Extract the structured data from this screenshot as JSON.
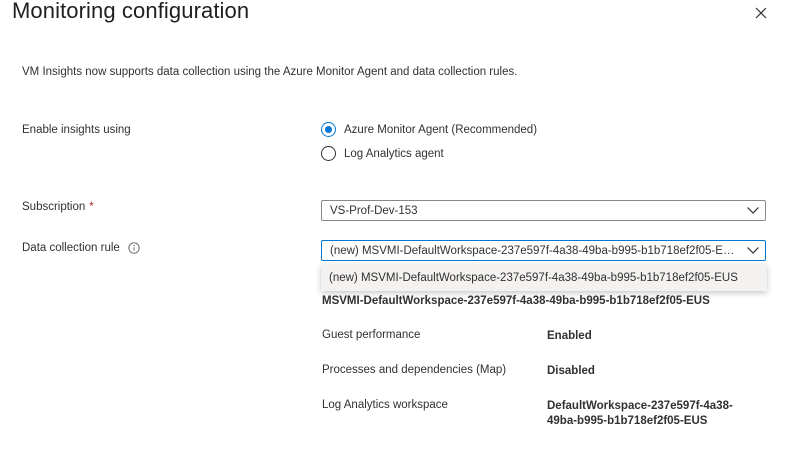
{
  "header": {
    "title": "Monitoring configuration",
    "close_icon": "close-icon"
  },
  "intro_text": "VM Insights now supports data collection using the Azure Monitor Agent and data collection rules.",
  "enable_insights": {
    "label": "Enable insights using",
    "options": [
      {
        "label": "Azure Monitor Agent (Recommended)",
        "selected": true
      },
      {
        "label": "Log Analytics agent",
        "selected": false
      }
    ]
  },
  "subscription": {
    "label": "Subscription",
    "required_marker": "*",
    "value": "VS-Prof-Dev-153"
  },
  "data_collection_rule": {
    "label": "Data collection rule",
    "info_icon": "info-icon",
    "value": "(new) MSVMI-DefaultWorkspace-237e597f-4a38-49ba-b995-b1b718ef2f05-EUS",
    "dropdown_options": [
      "(new) MSVMI-DefaultWorkspace-237e597f-4a38-49ba-b995-b1b718ef2f05-EUS"
    ]
  },
  "rule_details": {
    "name": "MSVMI-DefaultWorkspace-237e597f-4a38-49ba-b995-b1b718ef2f05-EUS",
    "rows": [
      {
        "label": "Guest performance",
        "value": "Enabled"
      },
      {
        "label": "Processes and dependencies (Map)",
        "value": "Disabled"
      },
      {
        "label": "Log Analytics workspace",
        "value_line1": "DefaultWorkspace-237e597f-4a38-",
        "value_line2": "49ba-b995-b1b718ef2f05-EUS"
      }
    ]
  },
  "colors": {
    "accent": "#0078d4",
    "required": "#a4262c",
    "text": "#323130"
  }
}
